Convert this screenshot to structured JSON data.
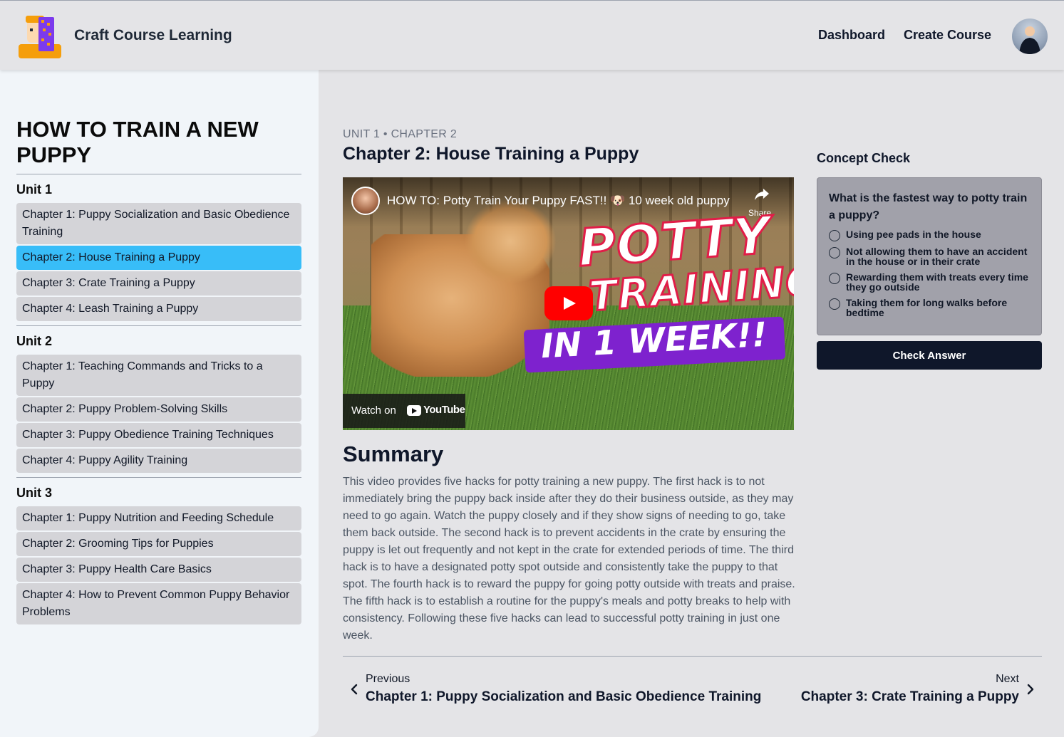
{
  "header": {
    "app_title": "Craft Course Learning",
    "nav": [
      "Dashboard",
      "Create Course"
    ]
  },
  "sidebar": {
    "course_title": "How to Train a New Puppy",
    "units": [
      {
        "label": "Unit 1",
        "chapters": [
          "Chapter 1: Puppy Socialization and Basic Obedience Training",
          "Chapter 2: House Training a Puppy",
          "Chapter 3: Crate Training a Puppy",
          "Chapter 4: Leash Training a Puppy"
        ]
      },
      {
        "label": "Unit 2",
        "chapters": [
          "Chapter 1: Teaching Commands and Tricks to a Puppy",
          "Chapter 2: Puppy Problem-Solving Skills",
          "Chapter 3: Puppy Obedience Training Techniques",
          "Chapter 4: Puppy Agility Training"
        ]
      },
      {
        "label": "Unit 3",
        "chapters": [
          "Chapter 1: Puppy Nutrition and Feeding Schedule",
          "Chapter 2: Grooming Tips for Puppies",
          "Chapter 3: Puppy Health Care Basics",
          "Chapter 4: How to Prevent Common Puppy Behavior Problems"
        ]
      }
    ],
    "active_chapter": "Chapter 2: House Training a Puppy",
    "active_color": "#38bdf8"
  },
  "main": {
    "breadcrumb": "Unit 1 • Chapter 2",
    "chapter_title": "Chapter 2: House Training a Puppy",
    "video": {
      "title": "HOW TO: Potty Train Your Puppy FAST!! 🐶 10 week old puppy",
      "share_label": "Share",
      "overlay_line1": "POTTY",
      "overlay_line2": "TRAINING",
      "overlay_line3": "IN 1 WEEK!!",
      "watch_on": "Watch on",
      "youtube_word": "YouTube"
    },
    "summary_heading": "Summary",
    "summary_text": "This video provides five hacks for potty training a new puppy. The first hack is to not immediately bring the puppy back inside after they do their business outside, as they may need to go again. Watch the puppy closely and if they show signs of needing to go, take them back outside. The second hack is to prevent accidents in the crate by ensuring the puppy is let out frequently and not kept in the crate for extended periods of time. The third hack is to have a designated potty spot outside and consistently take the puppy to that spot. The fourth hack is to reward the puppy for going potty outside with treats and praise. The fifth hack is to establish a routine for the puppy's meals and potty breaks to help with consistency. Following these five hacks can lead to successful potty training in just one week."
  },
  "concept_check": {
    "heading": "Concept Check",
    "question": "What is the fastest way to potty train a puppy?",
    "options": [
      "Using pee pads in the house",
      "Not allowing them to have an accident in the house or in their crate",
      "Rewarding them with treats every time they go outside",
      "Taking them for long walks before bedtime"
    ],
    "button_label": "Check Answer"
  },
  "bottom_nav": {
    "previous_label": "Previous",
    "previous_title": "Chapter 1: Puppy Socialization and Basic Obedience Training",
    "next_label": "Next",
    "next_title": "Chapter 3: Crate Training a Puppy"
  }
}
